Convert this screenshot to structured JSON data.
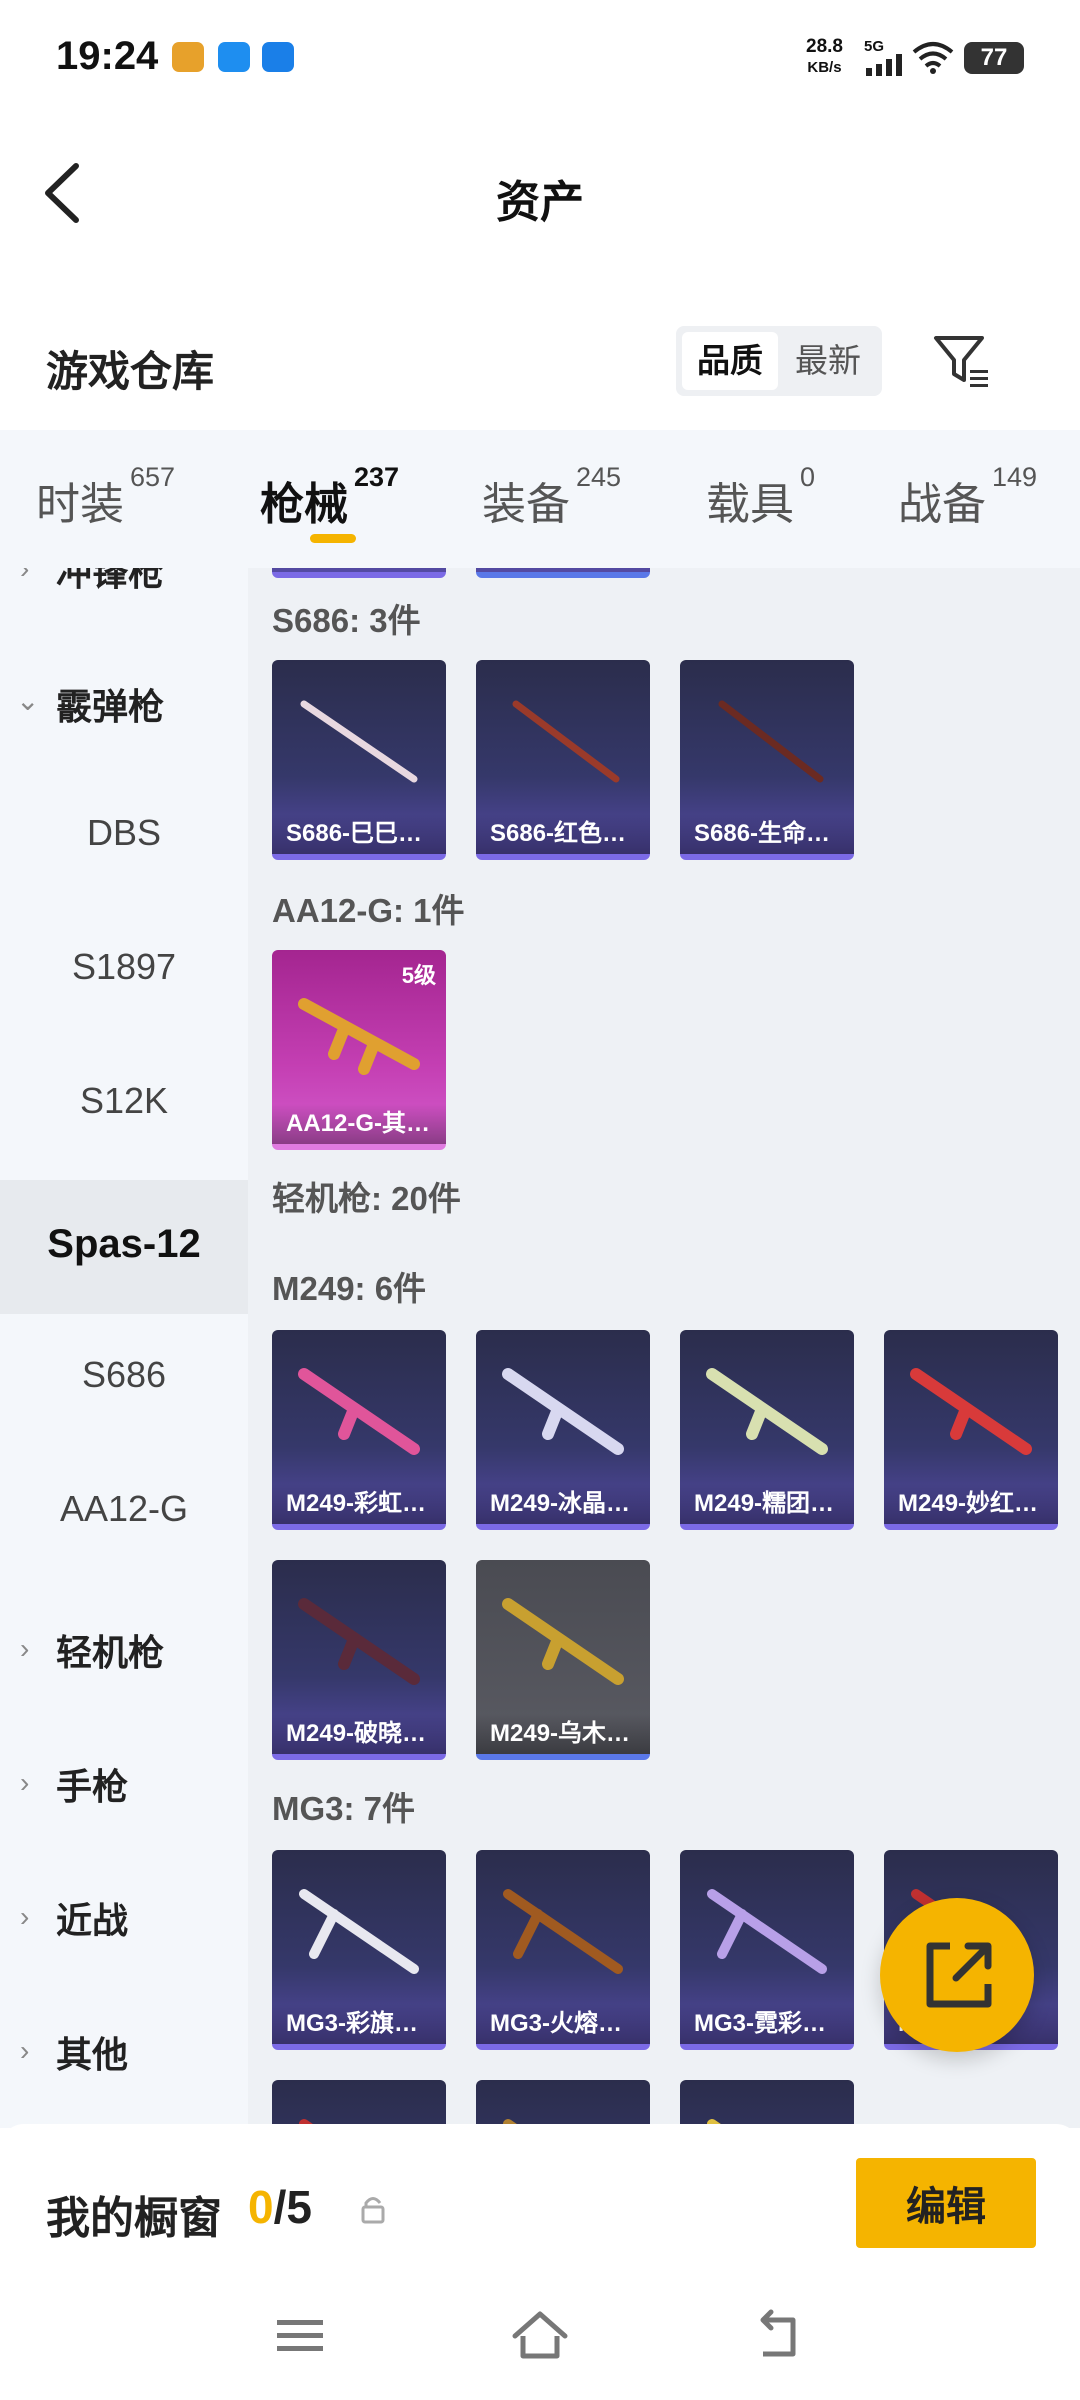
{
  "status_bar": {
    "time": "19:24",
    "net_speed": "28.8",
    "net_unit": "KB/s",
    "network": "5G",
    "battery": "77"
  },
  "header": {
    "title": "资产",
    "back_icon": "chevron-left-icon"
  },
  "section": {
    "title": "游戏仓库",
    "sort_options": [
      "品质",
      "最新"
    ],
    "sort_selected": "品质",
    "filter_icon": "filter-icon"
  },
  "tabs": [
    {
      "label": "时装",
      "count": "657"
    },
    {
      "label": "枪械",
      "count": "237",
      "active": true
    },
    {
      "label": "装备",
      "count": "245"
    },
    {
      "label": "载具",
      "count": "0"
    },
    {
      "label": "战备",
      "count": "149"
    }
  ],
  "sidebar": {
    "items": [
      {
        "label": "冲锋枪",
        "type": "category"
      },
      {
        "label": "霰弹枪",
        "type": "category",
        "expanded": true
      },
      {
        "label": "DBS",
        "type": "sub"
      },
      {
        "label": "S1897",
        "type": "sub"
      },
      {
        "label": "S12K",
        "type": "sub"
      },
      {
        "label": "Spas-12",
        "type": "sub",
        "selected": true
      },
      {
        "label": "S686",
        "type": "sub"
      },
      {
        "label": "AA12-G",
        "type": "sub"
      },
      {
        "label": "轻机枪",
        "type": "category"
      },
      {
        "label": "手枪",
        "type": "category"
      },
      {
        "label": "近战",
        "type": "category"
      },
      {
        "label": "其他",
        "type": "category"
      }
    ]
  },
  "content": {
    "groups": [
      {
        "header": "S686: 3件",
        "items": [
          {
            "name": "S686-巳巳…",
            "color": "#e8d8e0"
          },
          {
            "name": "S686-红色…",
            "color": "#9a3a2a"
          },
          {
            "name": "S686-生命…",
            "color": "#6b2a22"
          }
        ]
      },
      {
        "header": "AA12-G: 1件",
        "items": [
          {
            "name": "AA12-G-其…",
            "level": "5级",
            "color": "#e0a030",
            "style": "pink"
          }
        ]
      },
      {
        "header": "轻机枪: 20件",
        "items": []
      },
      {
        "header": "M249: 6件",
        "items": [
          {
            "name": "M249-彩虹…",
            "color": "#e0559a"
          },
          {
            "name": "M249-冰晶…",
            "color": "#d8d8f0"
          },
          {
            "name": "M249-糯团…",
            "color": "#d8e0b0"
          },
          {
            "name": "M249-妙红…",
            "color": "#d83a3a"
          },
          {
            "name": "M249-破晓…",
            "color": "#5a2a3a"
          },
          {
            "name": "M249-乌木…",
            "color": "#c8a030",
            "style": "gray"
          }
        ]
      },
      {
        "header": "MG3: 7件",
        "items": [
          {
            "name": "MG3-彩旗…",
            "color": "#e8e8f0"
          },
          {
            "name": "MG3-火熔…",
            "color": "#a05a20"
          },
          {
            "name": "MG3-霓彩…",
            "color": "#b8a0e8"
          },
          {
            "name": "MG3-…",
            "color": "#c03030"
          },
          {
            "name": "",
            "color": "#c03030"
          },
          {
            "name": "",
            "color": "#b08030"
          },
          {
            "name": "",
            "color": "#e0c040"
          }
        ]
      }
    ]
  },
  "fab": {
    "icon": "share-icon"
  },
  "showcase": {
    "label": "我的橱窗",
    "current": "0",
    "max": "/5",
    "lock_icon": "lock-icon",
    "edit_label": "编辑"
  },
  "navbar": {
    "menu_icon": "menu-icon",
    "home_icon": "home-icon",
    "back_icon": "back-icon"
  },
  "colors": {
    "accent": "#f5b400",
    "sidebar_bg": "#f4f7fb",
    "content_bg": "#eef1f5"
  }
}
